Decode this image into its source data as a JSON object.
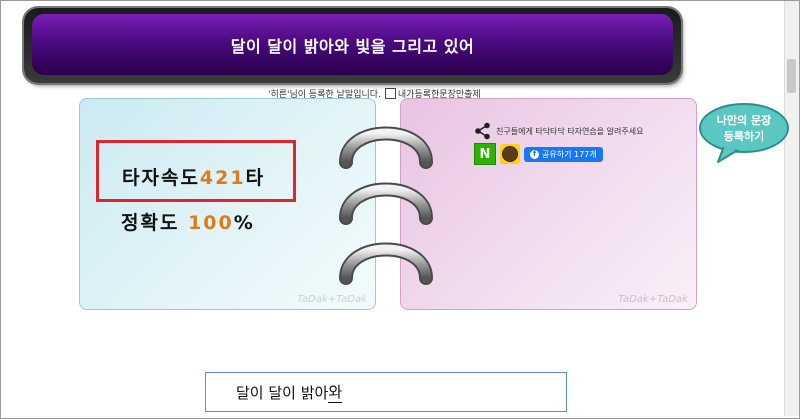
{
  "title": "달이 달이 밝아와 빛을 그리고 있어",
  "register_text": "'히른'님이 등록한 낱말입니다.",
  "register_checkbox_label": "내가등록한문장만출제",
  "stats": {
    "speed_label": "타자속도",
    "speed_value": "421",
    "speed_unit": "타",
    "accuracy_label": "정확도",
    "accuracy_value": "100",
    "accuracy_unit": "%"
  },
  "share": {
    "text": "친구들에게 타닥타닥 타자연습을 알려주세요",
    "naver_label": "N",
    "facebook_label": "공유하기 177개"
  },
  "watermark": "TaDak+TaDak",
  "bubble_text_line1": "나만의 문장",
  "bubble_text_line2": "등록하기",
  "input": {
    "typed_text": "달이 달이 밝아와",
    "typed_prefix": "달이 달이 밝아",
    "typed_last": "와"
  },
  "colors": {
    "accent_orange": "#e07b17",
    "highlight_red": "#e0242c",
    "title_purple": "#4a0a80",
    "naver_green": "#2db400",
    "kakao_yellow": "#ffd400",
    "facebook_blue": "#1877f2"
  }
}
